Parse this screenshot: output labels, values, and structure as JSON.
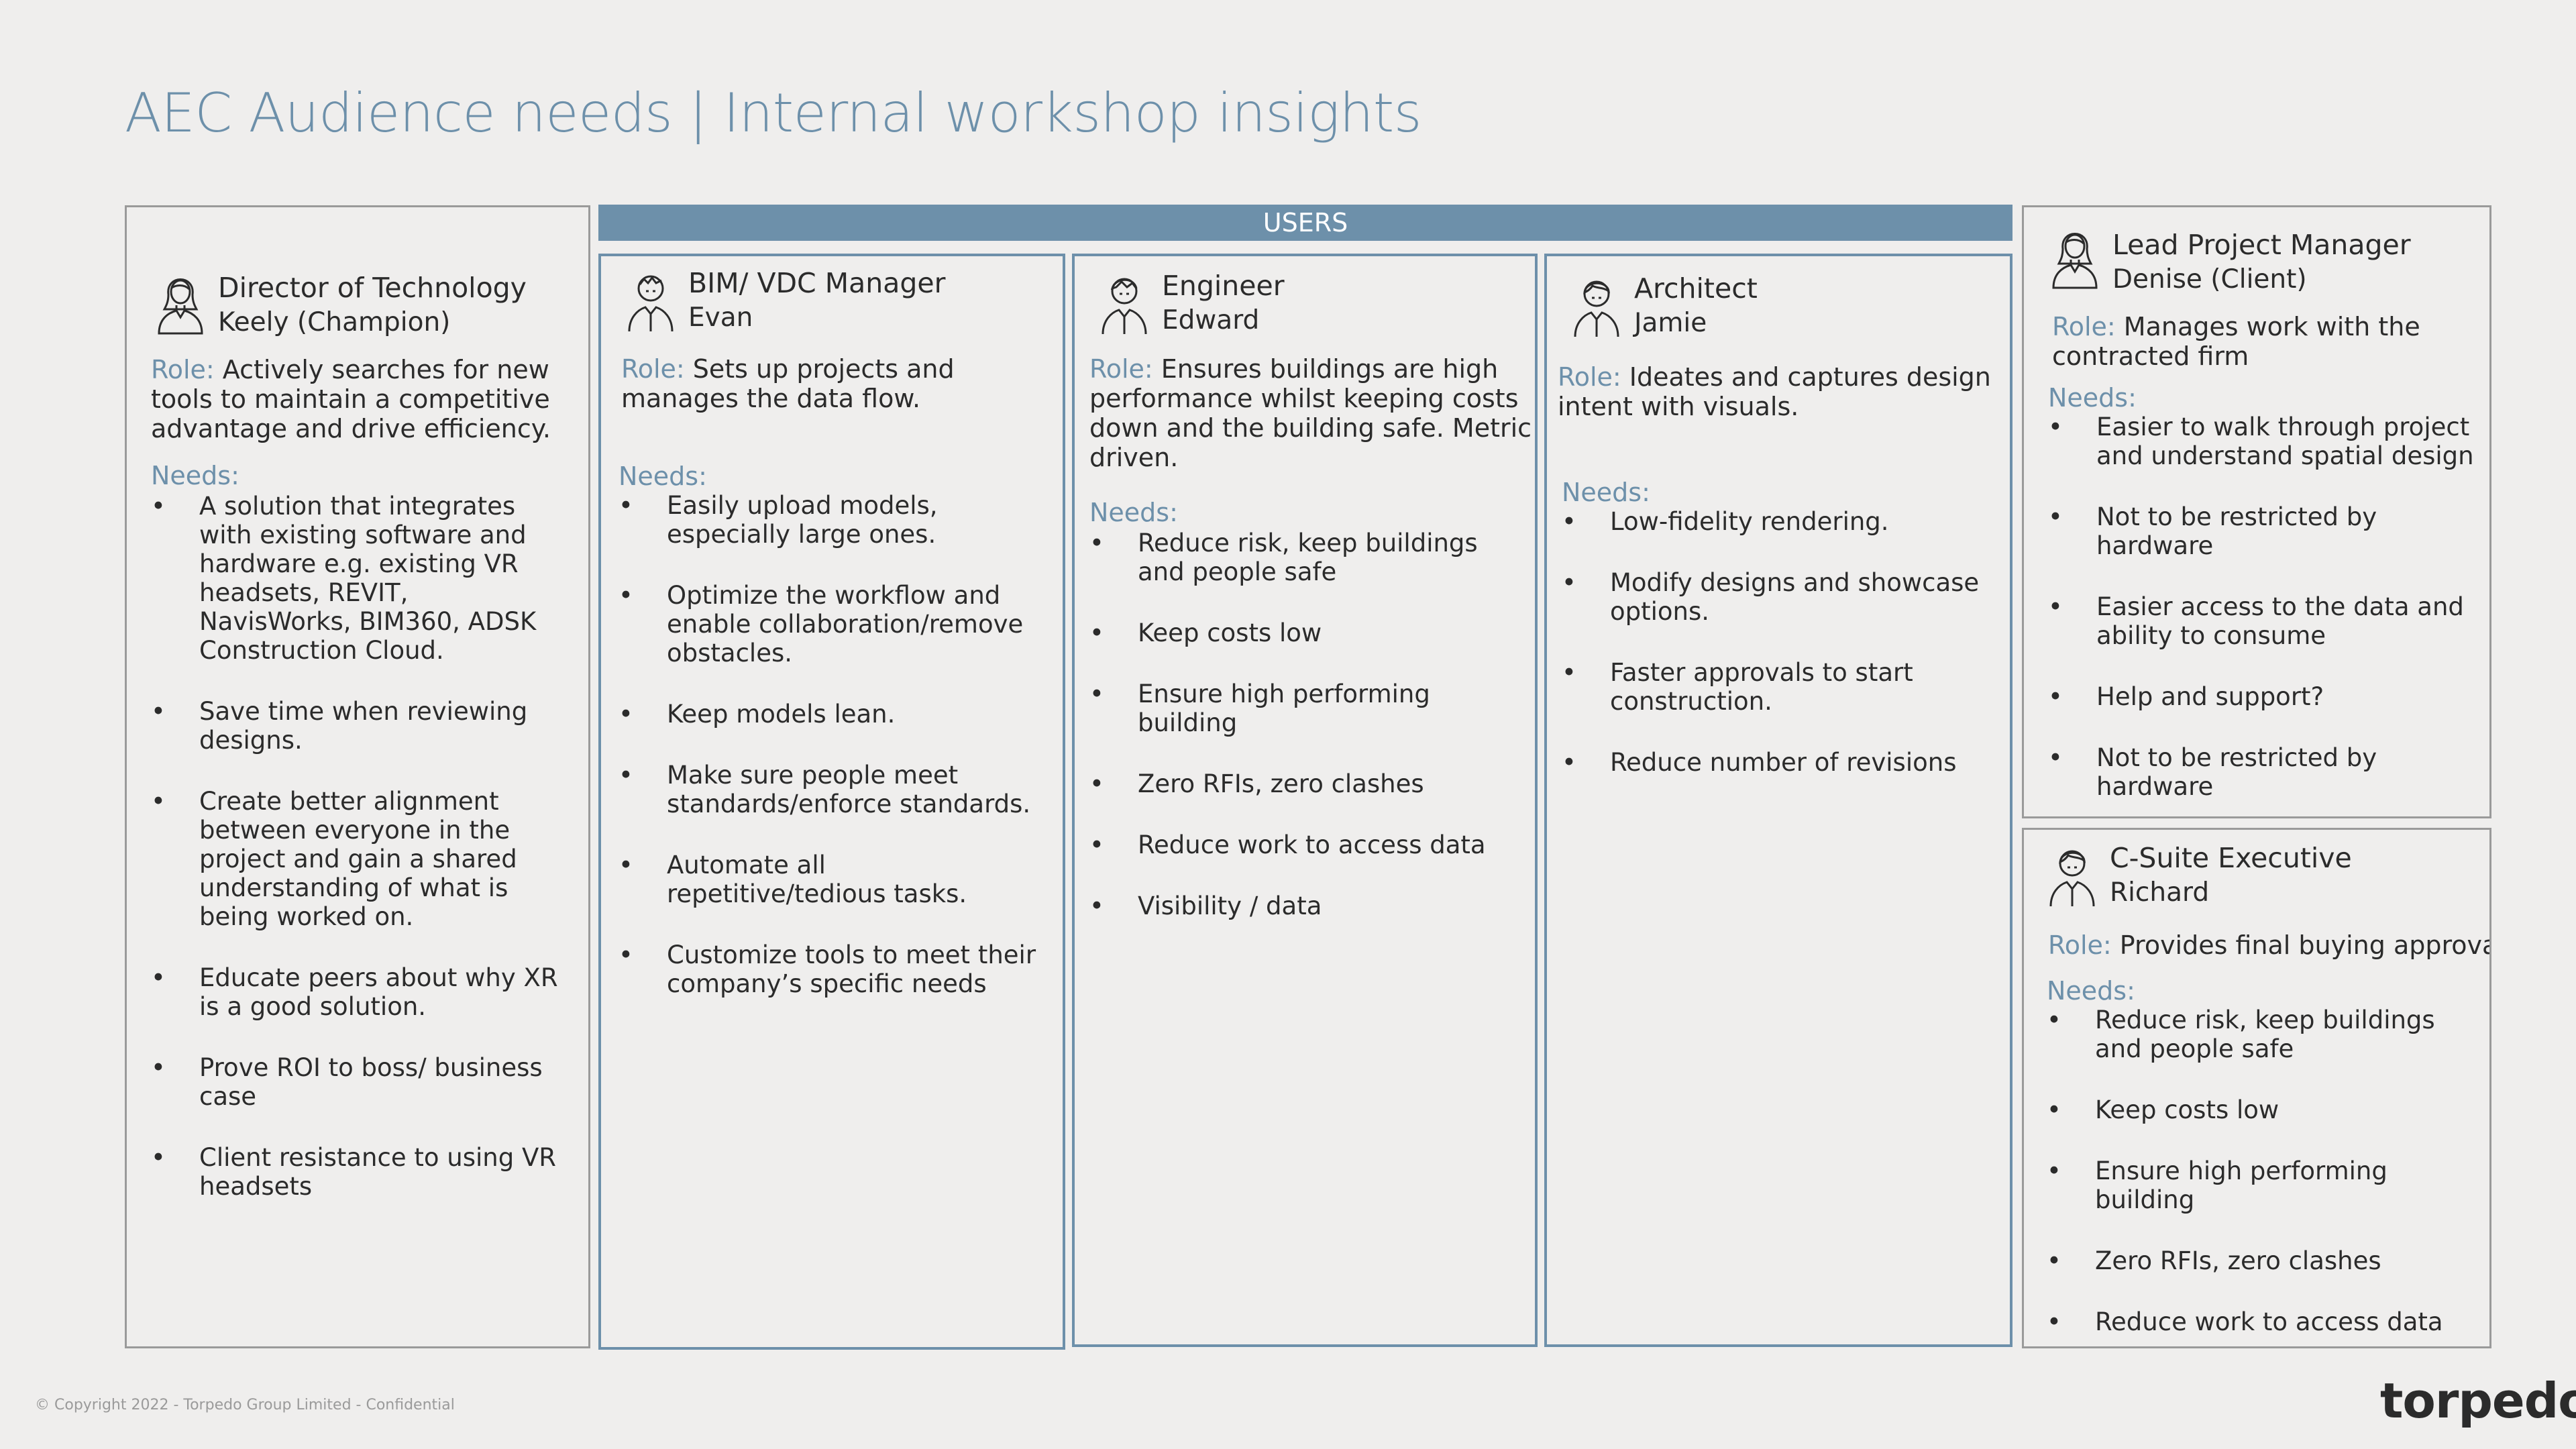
{
  "slide": {
    "title": "AEC Audience needs | Internal workshop insights",
    "users_label": "USERS",
    "copyright": "© Copyright 2022 - Torpedo Group Limited - Confidential",
    "logo": "torpedo"
  },
  "labels": {
    "role": "Role:",
    "needs": "Needs:"
  },
  "personas": {
    "director": {
      "title": "Director of Technology",
      "name": "Keely (Champion)",
      "role": "Actively searches for new tools to maintain a competitive advantage and drive efficiency.",
      "needs": [
        "A solution that integrates with existing software and hardware e.g. existing VR headsets, REVIT, NavisWorks, BIM360, ADSK Construction Cloud.",
        "Save time when reviewing designs.",
        "Create better alignment between everyone in the project and gain a shared understanding of what is being worked on.",
        "Educate peers about why XR is a good solution.",
        "Prove ROI to boss/ business case",
        "Client resistance to using VR headsets"
      ]
    },
    "bim": {
      "title": "BIM/ VDC Manager",
      "name": "Evan",
      "role": "Sets up projects and manages the data flow.",
      "needs": [
        "Easily upload models, especially large ones.",
        "Optimize the workflow and enable collaboration/remove obstacles.",
        "Keep models lean.",
        "Make sure people meet standards/enforce standards.",
        "Automate all repetitive/tedious tasks.",
        "Customize tools to meet their company’s specific needs"
      ]
    },
    "engineer": {
      "title": "Engineer",
      "name": "Edward",
      "role": "Ensures buildings are high performance whilst keeping costs down and the building safe. Metric driven.",
      "needs": [
        "Reduce risk, keep buildings and people safe",
        "Keep costs low",
        "Ensure high performing building",
        "Zero RFIs, zero clashes",
        "Reduce work to access data",
        "Visibility / data"
      ]
    },
    "architect": {
      "title": "Architect",
      "name": "Jamie",
      "role": "Ideates and captures design intent with visuals.",
      "needs": [
        "Low-fidelity rendering.",
        "Modify designs and showcase options.",
        "Faster approvals to start construction.",
        "Reduce number of revisions"
      ]
    },
    "pm": {
      "title": "Lead Project Manager",
      "name": "Denise  (Client)",
      "role": "Manages work with the contracted firm",
      "needs": [
        "Easier to walk through project and understand spatial design",
        "Not to be restricted by hardware",
        "Easier access to the data and ability to consume",
        "Help and support?",
        "Not to be restricted by hardware"
      ]
    },
    "csuite": {
      "title": "C-Suite Executive",
      "name": "Richard",
      "role": "Provides final buying approval",
      "needs": [
        "Reduce risk, keep buildings and people safe",
        "Keep costs low",
        "Ensure high performing building",
        "Zero RFIs, zero clashes",
        "Reduce work to access data"
      ]
    }
  },
  "icons": {
    "female": "female-user-icon",
    "male": "male-user-icon"
  }
}
